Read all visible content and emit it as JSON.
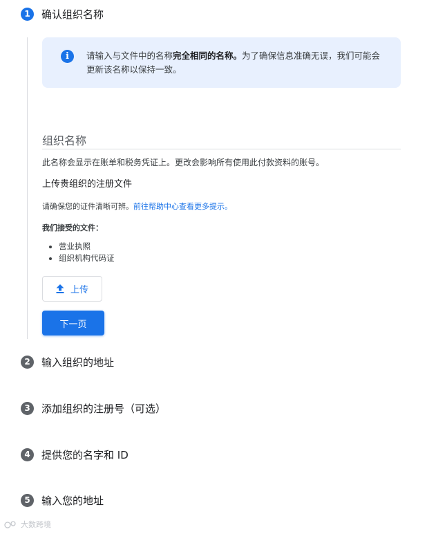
{
  "steps": [
    {
      "number": "1",
      "title": "确认组织名称",
      "state": "active"
    },
    {
      "number": "2",
      "title": "输入组织的地址",
      "state": "inactive"
    },
    {
      "number": "3",
      "title": "添加组织的注册号（可选）",
      "state": "inactive"
    },
    {
      "number": "4",
      "title": "提供您的名字和 ID",
      "state": "inactive"
    },
    {
      "number": "5",
      "title": "输入您的地址",
      "state": "inactive"
    }
  ],
  "info": {
    "icon": "info-icon",
    "text_before": "请输入与文件中的名称",
    "text_bold": "完全相同的名称。",
    "text_after": "为了确保信息准确无误，我们可能会更新该名称以保持一致。"
  },
  "org_name_field": {
    "label": "组织名称",
    "value": "",
    "hint": "此名称会显示在账单和税务凭证上。更改会影响所有使用此付款资料的账号。"
  },
  "upload_section": {
    "heading": "上传贵组织的注册文件",
    "hint_text": "请确保您的证件清晰可辨。",
    "help_link": "前往帮助中心查看更多提示。",
    "accepted_heading": "我们接受的文件：",
    "accepted_documents": [
      "营业执照",
      "组织机构代码证"
    ],
    "upload_button": "上传",
    "upload_icon": "upload-icon"
  },
  "next_button": "下一页",
  "watermark": "大数跨境",
  "colors": {
    "accent": "#1a73e8",
    "info_background": "#e8f0fe",
    "inactive_step": "#5f6368"
  }
}
